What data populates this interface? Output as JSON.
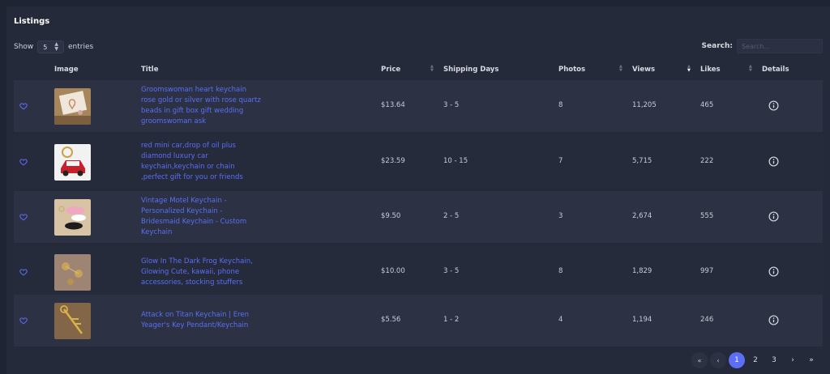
{
  "panel": {
    "title": "Listings",
    "show_label": "Show",
    "entries_value": "5",
    "entries_suffix": "entries",
    "search_label": "Search:",
    "search_placeholder": "Search..."
  },
  "columns": {
    "image": "Image",
    "title": "Title",
    "price": "Price",
    "shipping": "Shipping Days",
    "photos": "Photos",
    "views": "Views",
    "likes": "Likes",
    "details": "Details"
  },
  "rows": [
    {
      "title_lines": [
        "Groomswoman heart keychain",
        "rose gold or silver with rose quartz",
        "beads in gift box gift wedding",
        "groomswoman ask"
      ],
      "price": "$13.64",
      "shipping": "3 - 5",
      "photos": "8",
      "views": "11,205",
      "likes": "465",
      "icons": {
        "favorite": "heart-icon",
        "details": "info-icon"
      }
    },
    {
      "title_lines": [
        "red mini car,drop of oil plus",
        "diamond luxury car",
        "keychain,keychain or chain",
        ",perfect gift for you or friends"
      ],
      "price": "$23.59",
      "shipping": "10 - 15",
      "photos": "7",
      "views": "5,715",
      "likes": "222",
      "icons": {
        "favorite": "heart-icon",
        "details": "info-icon"
      }
    },
    {
      "title_lines": [
        "Vintage Motel Keychain -",
        "Personalized Keychain -",
        "Bridesmaid Keychain - Custom",
        "Keychain"
      ],
      "price": "$9.50",
      "shipping": "2 - 5",
      "photos": "3",
      "views": "2,674",
      "likes": "555",
      "icons": {
        "favorite": "heart-icon",
        "details": "info-icon"
      }
    },
    {
      "title_lines": [
        "Glow In The Dark Frog Keychain,",
        "Glowing Cute, kawaii, phone",
        "accessories, stocking stuffers"
      ],
      "price": "$10.00",
      "shipping": "3 - 5",
      "photos": "8",
      "views": "1,829",
      "likes": "997",
      "icons": {
        "favorite": "heart-icon",
        "details": "info-icon"
      }
    },
    {
      "title_lines": [
        "Attack on Titan Keychain | Eren",
        "Yeager's Key Pendant/Keychain"
      ],
      "price": "$5.56",
      "shipping": "1 - 2",
      "photos": "4",
      "views": "1,194",
      "likes": "246",
      "icons": {
        "favorite": "heart-icon",
        "details": "info-icon"
      }
    }
  ],
  "pagination": {
    "first": "«",
    "prev": "‹",
    "pages": [
      "1",
      "2",
      "3"
    ],
    "active_page": "1",
    "next": "›",
    "last": "»"
  },
  "colors": {
    "accent": "#5b6ef5",
    "background": "#1f2433",
    "panel": "#252a3b",
    "row_alt": "#2c3244"
  }
}
